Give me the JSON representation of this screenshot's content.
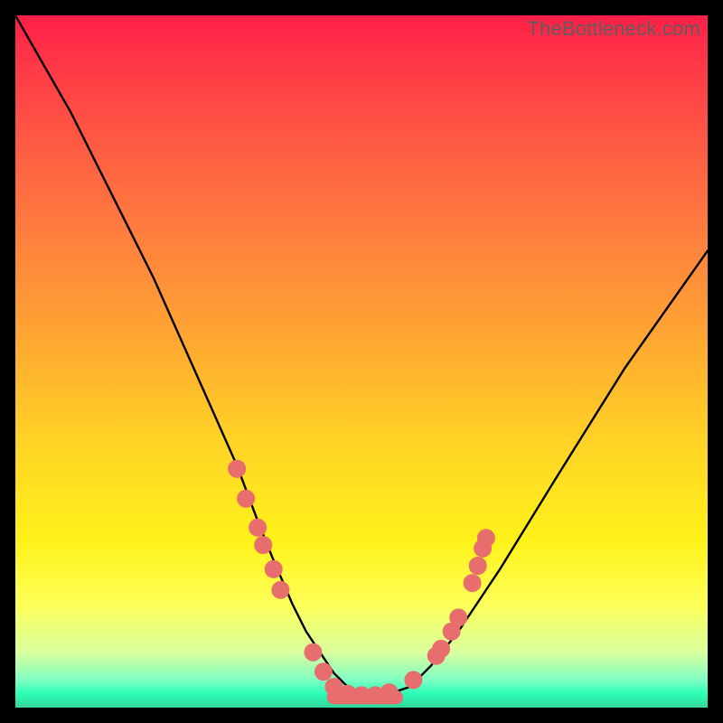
{
  "watermark": "TheBottleneck.com",
  "chart_data": {
    "type": "line",
    "title": "",
    "xlabel": "",
    "ylabel": "",
    "xlim": [
      0,
      100
    ],
    "ylim": [
      0,
      100
    ],
    "note": "Axes are unlabeled; x/y expressed in percent of plot area. y=100 at top, y=0 at bottom.",
    "series": [
      {
        "name": "bottleneck-curve",
        "x": [
          0,
          4,
          8,
          12,
          16,
          20,
          24,
          28,
          32,
          35,
          37,
          40,
          42,
          44,
          46,
          48,
          50,
          52,
          54,
          57,
          60,
          64,
          70,
          78,
          88,
          100
        ],
        "y": [
          100,
          93,
          86,
          78,
          70,
          62,
          53,
          44,
          35,
          27,
          22,
          15,
          11,
          8,
          5,
          3,
          2,
          2,
          2,
          3,
          6,
          11,
          20,
          33,
          49,
          66
        ]
      }
    ],
    "markers": {
      "name": "highlighted-points",
      "color": "#e86d6d",
      "radius_percent": 1.3,
      "points": [
        {
          "x": 32.0,
          "y": 34.5
        },
        {
          "x": 33.3,
          "y": 30.2
        },
        {
          "x": 35.0,
          "y": 26.0
        },
        {
          "x": 35.8,
          "y": 23.5
        },
        {
          "x": 37.3,
          "y": 20.0
        },
        {
          "x": 38.3,
          "y": 17.0
        },
        {
          "x": 43.0,
          "y": 8.0
        },
        {
          "x": 44.5,
          "y": 5.2
        },
        {
          "x": 46.0,
          "y": 3.0
        },
        {
          "x": 48.0,
          "y": 2.0
        },
        {
          "x": 50.0,
          "y": 1.8
        },
        {
          "x": 52.0,
          "y": 1.8
        },
        {
          "x": 54.0,
          "y": 2.2
        },
        {
          "x": 57.5,
          "y": 4.0
        },
        {
          "x": 60.8,
          "y": 7.5
        },
        {
          "x": 61.5,
          "y": 8.5
        },
        {
          "x": 63.0,
          "y": 11.0
        },
        {
          "x": 64.0,
          "y": 13.0
        },
        {
          "x": 66.0,
          "y": 18.0
        },
        {
          "x": 66.8,
          "y": 20.5
        },
        {
          "x": 67.5,
          "y": 23.0
        },
        {
          "x": 68.0,
          "y": 24.5
        }
      ]
    },
    "bottom_band": {
      "name": "optimal-range-band",
      "color": "#e86d6d",
      "x_start": 45.0,
      "x_end": 56.0,
      "y": 1.5,
      "thickness_percent": 2.0
    }
  }
}
